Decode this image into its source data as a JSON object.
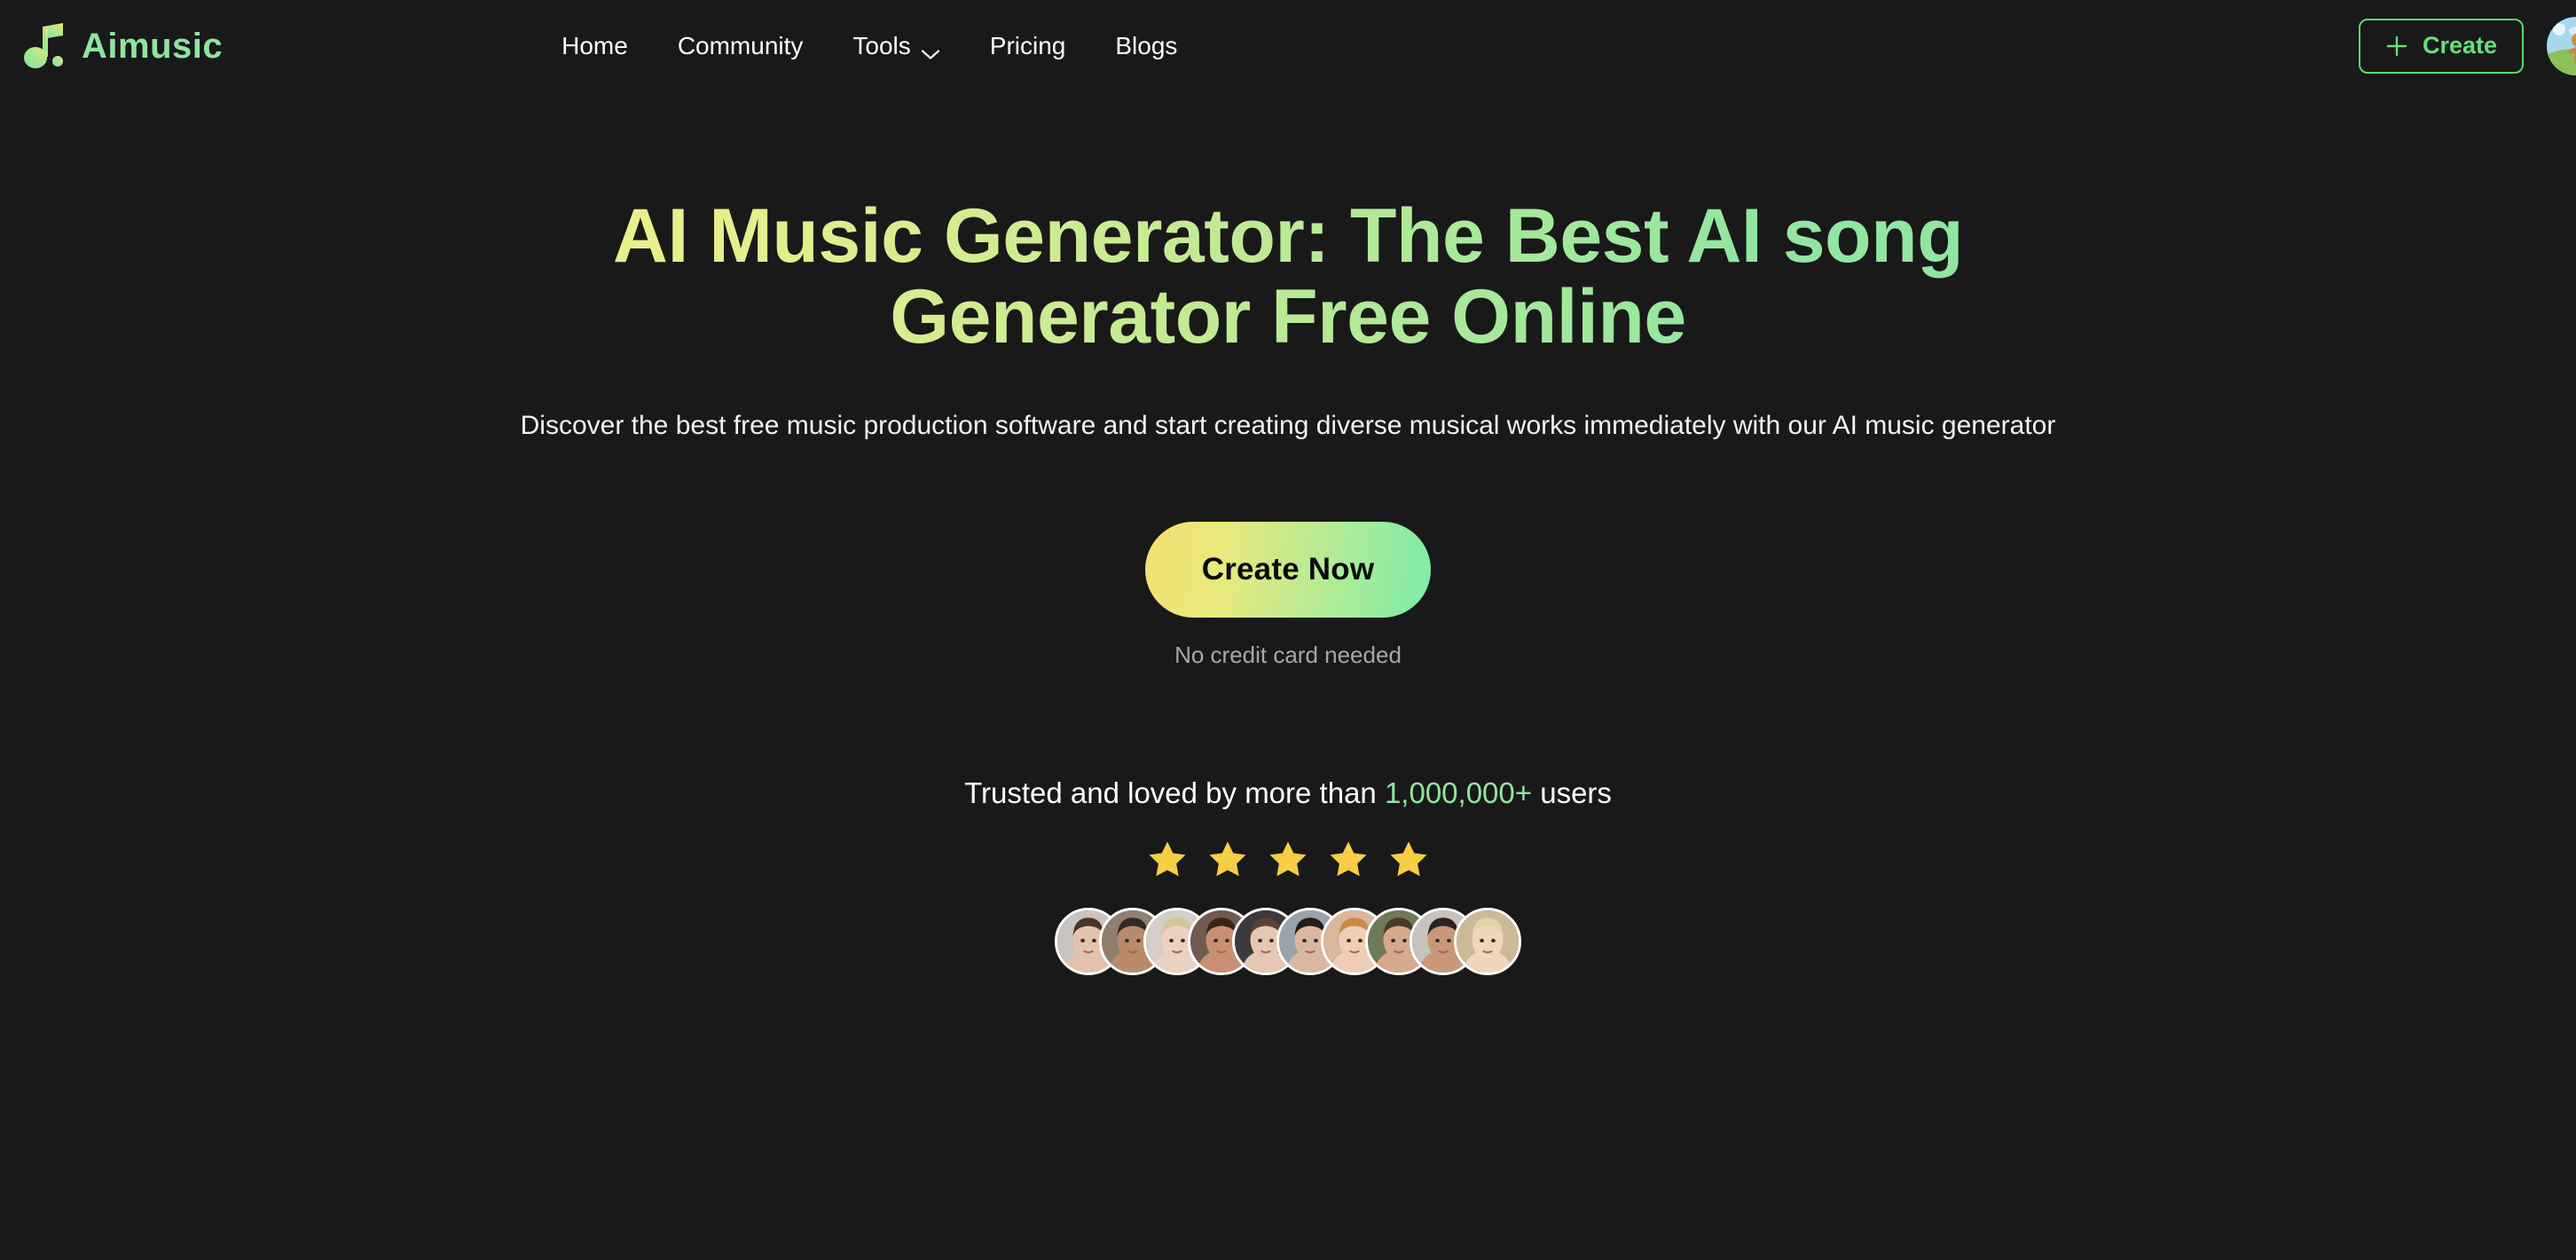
{
  "theme": {
    "background": "#191919",
    "accent_green": "#8FE6A0",
    "accent_yellow": "#EFF08A",
    "star_color": "#F5CE45",
    "muted_text": "#A7A7A7"
  },
  "header": {
    "brand": {
      "name": "Aimusic",
      "icon": "music-note-icon"
    },
    "nav": [
      {
        "label": "Home",
        "has_chevron": false
      },
      {
        "label": "Community",
        "has_chevron": false
      },
      {
        "label": "Tools",
        "has_chevron": true
      },
      {
        "label": "Pricing",
        "has_chevron": false
      },
      {
        "label": "Blogs",
        "has_chevron": false
      }
    ],
    "create_button": {
      "label": "Create",
      "icon": "plus-icon"
    },
    "user_avatar": "user-avatar"
  },
  "hero": {
    "headline": "AI Music Generator: The Best AI song Generator Free Online",
    "subtitle": "Discover the best free music production software and start creating diverse musical works immediately with our AI music generator",
    "cta_label": "Create Now",
    "no_credit_card": "No credit card needed"
  },
  "social_proof": {
    "trusted_prefix": "Trusted and loved by more than ",
    "user_count": "1,000,000+",
    "trusted_suffix": " users",
    "star_count": 5,
    "avatar_count": 10
  }
}
